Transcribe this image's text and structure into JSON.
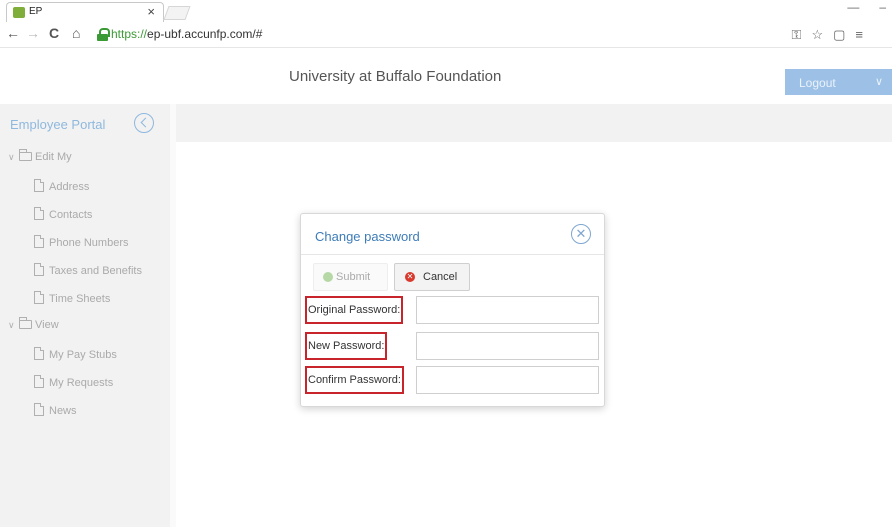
{
  "browser": {
    "tab_title": "EP",
    "tab_close": "×",
    "url_scheme": "https://",
    "url_rest": "ep-ubf.accunfp.com/#",
    "back": "←",
    "forward": "→",
    "reload": "C",
    "home": "⌂",
    "key_icon": "⚿",
    "star_icon": "☆",
    "menu_icon": "≡",
    "ext_icon": "▢",
    "min": "—",
    "max": "–",
    "close": "✕"
  },
  "header": {
    "title": "University at Buffalo Foundation",
    "logout_label": "Logout",
    "logout_chevron": "∨"
  },
  "sidebar": {
    "portal_title": "Employee Portal",
    "groups": [
      {
        "label": "Edit My",
        "items": [
          "Address",
          "Contacts",
          "Phone Numbers",
          "Taxes and Benefits",
          "Time Sheets"
        ]
      },
      {
        "label": "View",
        "items": [
          "My Pay Stubs",
          "My Requests",
          "News"
        ]
      }
    ],
    "caret": "∨"
  },
  "modal": {
    "title": "Change password",
    "close_glyph": "✕",
    "submit_label": "Submit",
    "cancel_label": "Cancel",
    "cancel_glyph": "✕",
    "fields": [
      {
        "label": "Original Password:",
        "value": ""
      },
      {
        "label": "New Password:",
        "value": ""
      },
      {
        "label": "Confirm Password:",
        "value": ""
      }
    ]
  },
  "colors": {
    "accent": "#3d7cb8",
    "logout_bg": "#9dc1e6",
    "highlight": "#c8242c",
    "sidebar_bg": "#f2f2f2"
  }
}
